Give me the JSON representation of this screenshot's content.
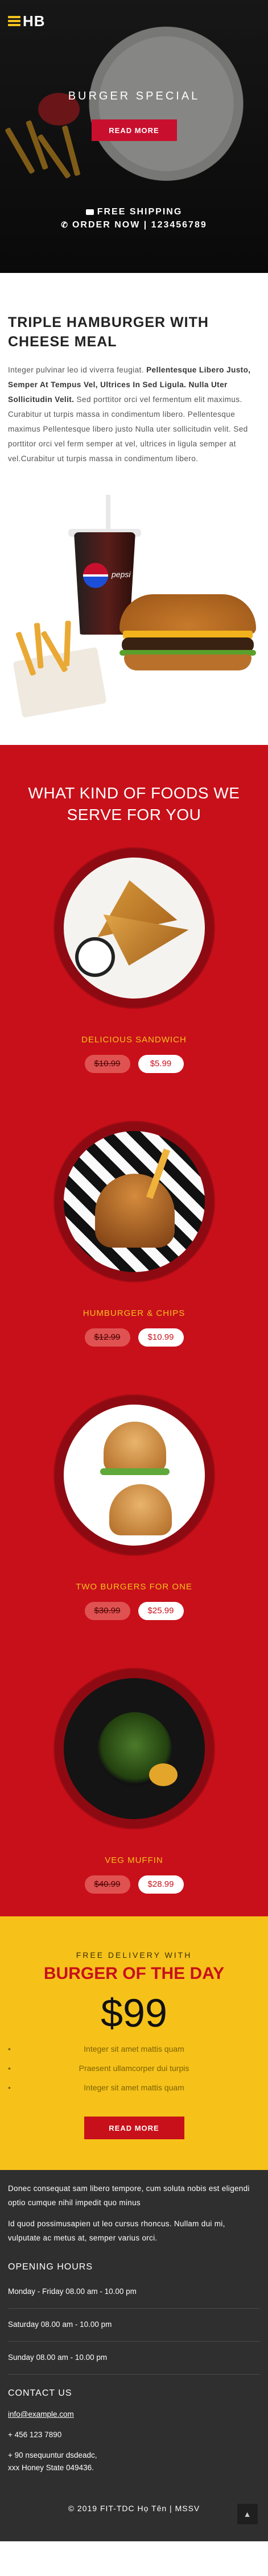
{
  "header": {
    "logo_text": "HB"
  },
  "hero": {
    "title": "BURGER SPECIAL",
    "button_label": "READ MORE",
    "shipping_text": "FREE SHIPPING",
    "order_text": "ORDER NOW | 123456789"
  },
  "intro": {
    "title": "TRIPLE HAMBURGER WITH CHEESE MEAL",
    "text_start": "Integer pulvinar leo id viverra feugiat. ",
    "text_bold": "Pellentesque Libero Justo, Semper At Tempus Vel, Ultrices In Sed Ligula. Nulla Uter Sollicitudin Velit.",
    "text_end": " Sed porttitor orci vel fermentum elit maximus. Curabitur ut turpis massa in condimentum libero. Pellentesque maximus Pellentesque libero justo Nulla uter sollicitudin velit. Sed porttitor orci vel ferm semper at vel, ultrices in ligula semper at vel.Curabitur ut turpis massa in condimentum libero."
  },
  "product": {
    "brand_text": "pepsi"
  },
  "menu": {
    "title": "WHAT KIND OF FOODS WE SERVE FOR YOU",
    "items": [
      {
        "name": "DELICIOUS SANDWICH",
        "old_price": "$10.99",
        "new_price": "$5.99"
      },
      {
        "name": "HUMBURGER & CHIPS",
        "old_price": "$12.99",
        "new_price": "$10.99"
      },
      {
        "name": "TWO BURGERS FOR ONE",
        "old_price": "$30.99",
        "new_price": "$25.99"
      },
      {
        "name": "VEG MUFFIN",
        "old_price": "$40.99",
        "new_price": "$28.99"
      }
    ]
  },
  "delivery": {
    "subtitle": "FREE DELIVERY WITH",
    "title": "BURGER OF THE DAY",
    "price": "$99",
    "features": [
      "Integer sit amet mattis quam",
      "Praesent ullamcorper dui turpis",
      "Integer sit amet mattis quam"
    ],
    "button_label": "READ MORE"
  },
  "footer": {
    "paragraph_1": "Donec consequat sam libero tempore, cum soluta nobis est eligendi optio cumque nihil impedit quo minus",
    "paragraph_2": "Id quod possimusapien ut leo cursus rhoncus. Nullam dui mi, vulputate ac metus at, semper varius orci.",
    "hours_title": "OPENING HOURS",
    "hours": [
      "Monday - Friday 08.00 am - 10.00 pm",
      "Saturday 08.00 am - 10.00 pm",
      "Sunday 08.00 am - 10.00 pm"
    ],
    "contact_title": "CONTACT US",
    "email": "info@example.com",
    "phone": "+ 456 123 7890",
    "address_line_1": "+ 90 nsequuntur dsdeadc,",
    "address_line_2": "xxx Honey State 049436.",
    "copyright": "© 2019 FIT-TDC Họ Tên | MSSV",
    "to_top_icon": "chevron-up-icon"
  },
  "colors": {
    "brand_red": "#c8101a",
    "brand_yellow": "#f6c21a",
    "footer_bg": "#2f2f2f"
  }
}
